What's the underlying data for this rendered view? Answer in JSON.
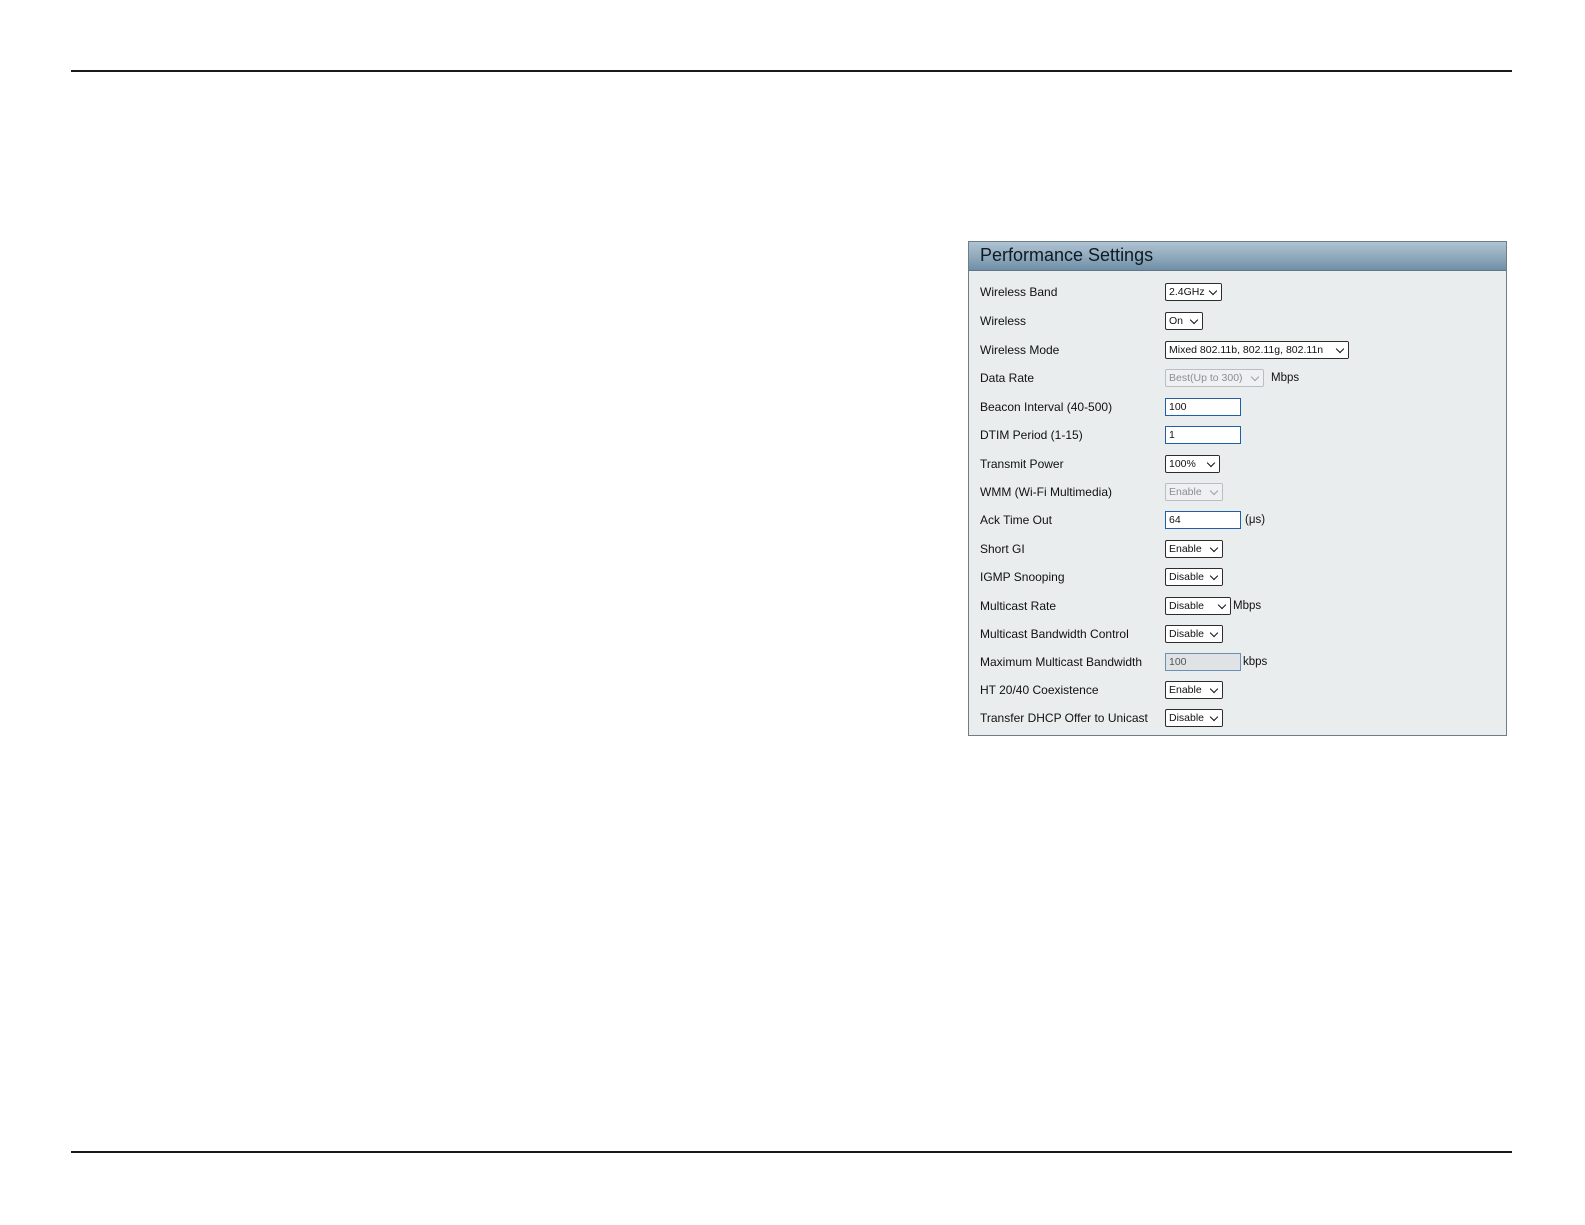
{
  "panel": {
    "title": "Performance Settings",
    "rows": [
      {
        "label": "Wireless Band",
        "control": "select",
        "value": "2.4GHz"
      },
      {
        "label": "Wireless",
        "control": "select",
        "value": "On"
      },
      {
        "label": "Wireless Mode",
        "control": "select",
        "value": "Mixed 802.11b, 802.11g, 802.11n"
      },
      {
        "label": "Data Rate",
        "control": "select",
        "value": "Best(Up to 300)",
        "disabled": true,
        "unit": "Mbps"
      },
      {
        "label": "Beacon Interval (40-500)",
        "control": "input",
        "value": "100"
      },
      {
        "label": "DTIM Period (1-15)",
        "control": "input",
        "value": "1"
      },
      {
        "label": "Transmit Power",
        "control": "select",
        "value": "100%"
      },
      {
        "label": "WMM (Wi-Fi Multimedia)",
        "control": "select",
        "value": "Enable",
        "disabled": true
      },
      {
        "label": "Ack Time Out",
        "control": "input",
        "value": "64",
        "unit": "(μs)"
      },
      {
        "label": "Short GI",
        "control": "select",
        "value": "Enable"
      },
      {
        "label": "IGMP Snooping",
        "control": "select",
        "value": "Disable"
      },
      {
        "label": "Multicast Rate",
        "control": "select",
        "value": "Disable",
        "unit": "Mbps"
      },
      {
        "label": "Multicast Bandwidth Control",
        "control": "select",
        "value": "Disable"
      },
      {
        "label": "Maximum Multicast Bandwidth",
        "control": "input",
        "value": "100",
        "disabled": true,
        "unit": "kbps"
      },
      {
        "label": "HT 20/40 Coexistence",
        "control": "select",
        "value": "Enable"
      },
      {
        "label": "Transfer DHCP Offer to Unicast",
        "control": "select",
        "value": "Disable"
      }
    ]
  }
}
